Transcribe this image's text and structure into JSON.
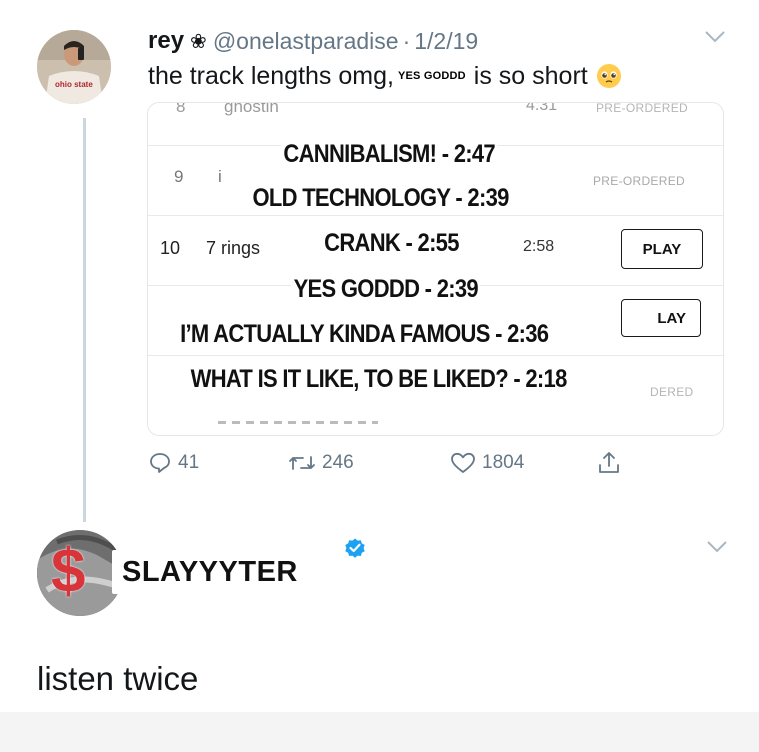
{
  "tweet": {
    "display_name": "rey",
    "name_symbol": "❀",
    "handle": "@onelastparadise",
    "separator": "·",
    "date": "1/2/19",
    "text_before": "the track lengths omg,",
    "sticker_text": "YES GODDD",
    "text_after": "is so short",
    "avatar_shirt_text": "ohio state",
    "card": {
      "rows": [
        {
          "num": "8",
          "title": "ghostin",
          "time": "4:31",
          "status": "PRE-ORDERED"
        },
        {
          "num": "9",
          "title": "i",
          "status": "PRE-ORDERED"
        },
        {
          "num": "10",
          "title": "7 rings",
          "time": "2:58",
          "button": "PLAY"
        },
        {
          "button_partial": "LAY"
        },
        {
          "status_partial": "DERED"
        }
      ]
    },
    "overlay_tracks": [
      "CANNIBALISM! - 2:47",
      "OLD TECHNOLOGY - 2:39",
      "CRANK - 2:55",
      "YES GODDD - 2:39",
      "I’M ACTUALLY KINDA FAMOUS - 2:36",
      "WHAT IS IT LIKE, TO BE LIKED? - 2:18"
    ],
    "actions": {
      "replies": "41",
      "retweets": "246",
      "likes": "1804"
    }
  },
  "reply": {
    "display_name": "SLAYYYTER",
    "text": "listen twice",
    "avatar_symbol": "$"
  },
  "colors": {
    "muted": "#657786",
    "verified": "#1da1f2",
    "thread_line": "#ccd6dd",
    "border": "#e1e8ed"
  }
}
